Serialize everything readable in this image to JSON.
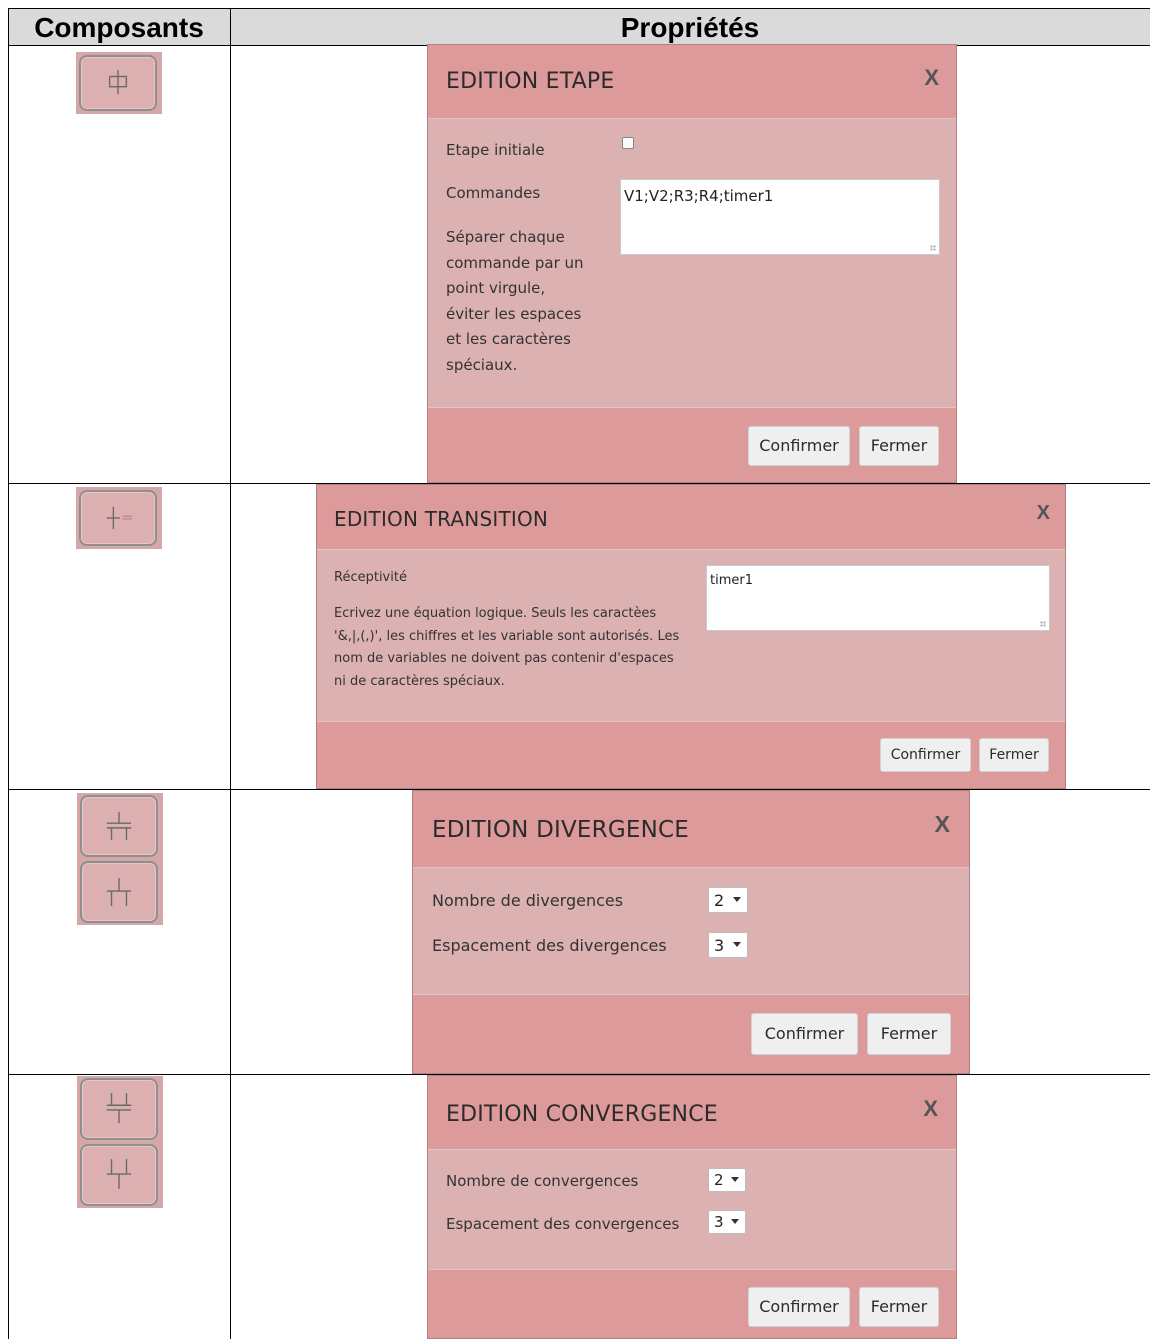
{
  "table": {
    "col_components": "Composants",
    "col_properties": "Propriétés"
  },
  "icons": {
    "step": "step-icon",
    "transition": "transition-icon",
    "divergence_and": "divergence-and-icon",
    "divergence_or": "divergence-or-icon",
    "convergence_and": "convergence-and-icon",
    "convergence_or": "convergence-or-icon"
  },
  "dialogs": {
    "etape": {
      "title": "EDITION ETAPE",
      "close": "X",
      "initial_label": "Etape initiale",
      "initial_checked": false,
      "commands_label": "Commandes",
      "commands_value": "V1;V2;R3;R4;timer1",
      "help_lines": [
        "Séparer chaque",
        "commande par un",
        "point virgule,",
        "éviter les espaces",
        "et les caractères",
        "spéciaux."
      ],
      "confirm": "Confirmer",
      "close_button": "Fermer"
    },
    "transition": {
      "title": "EDITION TRANSITION",
      "close": "X",
      "receptivity_label": "Réceptivité",
      "receptivity_value": "timer1",
      "help_lines": [
        "Ecrivez une équation logique. Seuls les caractèes",
        "'&,|,(,)', les chiffres et les variable sont autorisés. Les",
        "nom de variables ne doivent pas contenir d'espaces",
        "ni de caractères spéciaux."
      ],
      "confirm": "Confirmer",
      "close_button": "Fermer"
    },
    "divergence": {
      "title": "EDITION DIVERGENCE",
      "close": "X",
      "count_label": "Nombre de divergences",
      "count_value": "2",
      "spacing_label": "Espacement des divergences",
      "spacing_value": "3",
      "confirm": "Confirmer",
      "close_button": "Fermer"
    },
    "convergence": {
      "title": "EDITION CONVERGENCE",
      "close": "X",
      "count_label": "Nombre de convergences",
      "count_value": "2",
      "spacing_label": "Espacement des convergences",
      "spacing_value": "3",
      "confirm": "Confirmer",
      "close_button": "Fermer"
    }
  },
  "colors": {
    "dialog_header": "#dd9a9b",
    "dialog_body": "#dcb1b2",
    "table_header": "#dadada"
  }
}
